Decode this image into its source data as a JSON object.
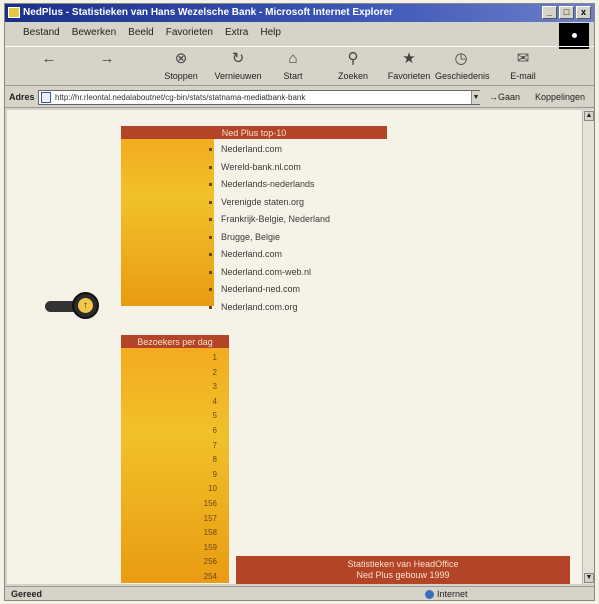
{
  "window": {
    "title": "NedPlus - Statistieken van Hans Wezelsche Bank - Microsoft Internet Explorer",
    "controls": [
      "_",
      "□",
      "x"
    ]
  },
  "menu": [
    "Bestand",
    "Bewerken",
    "Beeld",
    "Favorieten",
    "Extra",
    "Help"
  ],
  "toolbar": {
    "buttons": [
      {
        "label": "",
        "icon": "back-icon"
      },
      {
        "label": "",
        "icon": "forward-icon"
      },
      {
        "label": "Stoppen",
        "icon": "stop-icon"
      },
      {
        "label": "Vernieuwen",
        "icon": "refresh-icon"
      },
      {
        "label": "Start",
        "icon": "home-icon"
      },
      {
        "label": "Zoeken",
        "icon": "search-icon"
      },
      {
        "label": "Favorieten",
        "icon": "favorites-icon"
      },
      {
        "label": "Geschiedenis",
        "icon": "history-icon"
      },
      {
        "label": "E-mail",
        "icon": "mail-icon"
      }
    ]
  },
  "address": {
    "label": "Adres",
    "url": "http://hr.rleontal.nedalaboutnet/cg-bin/stats/statnama-mediatbank-bank",
    "go": "Gaan",
    "links": "Koppelingen"
  },
  "table1": {
    "header": "Ned Plus top-10",
    "items": [
      "Nederland.com",
      "Wereld-bank.nl.com",
      "Nederlands-nederlands",
      "Verenigde staten.org",
      "Frankrijk-Belgie, Nederland",
      "Brugge, Belgie",
      "Nederland.com",
      "Nederland.com-web.nl",
      "Nederland-ned.com",
      "Nederland.com.org"
    ]
  },
  "table2": {
    "header": "Bezoekers per dag",
    "numbers": [
      "1",
      "2",
      "3",
      "4",
      "5",
      "6",
      "7",
      "8",
      "9",
      "10",
      "156",
      "157",
      "158",
      "159",
      "256",
      "254"
    ]
  },
  "footer_box": {
    "line1": "Statistieken van HeadOffice",
    "line2": "Ned Plus gebouw 1999"
  },
  "status": {
    "text": "Gereed",
    "zone": "Internet"
  },
  "colors": {
    "header": "#b34427",
    "column": "#f3a81d",
    "title_bar": "#1a2f8a"
  }
}
